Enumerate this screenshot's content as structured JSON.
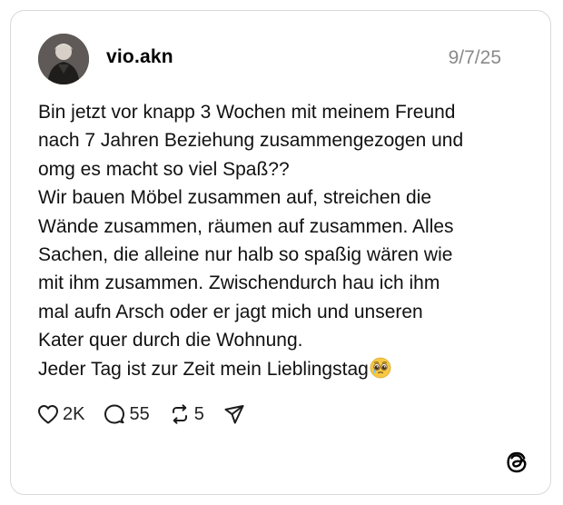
{
  "post": {
    "username": "vio.akn",
    "date": "9/7/25",
    "lines": [
      "Bin jetzt vor knapp 3 Wochen mit meinem Freund",
      "nach 7 Jahren Beziehung zusammengezogen und",
      "omg es macht so viel Spaß??",
      "Wir bauen Möbel zusammen auf, streichen die",
      "Wände zusammen, räumen auf zusammen. Alles",
      "Sachen, die alleine nur halb so spaßig wären wie",
      "mit ihm zusammen. Zwischendurch hau ich ihm",
      "mal aufn Arsch oder er jagt mich und unseren",
      "Kater quer durch die Wohnung.",
      "Jeder Tag ist zur Zeit mein Lieblingstag"
    ],
    "emoji": "pleading-face-emoji"
  },
  "actions": {
    "likes": "2K",
    "replies": "55",
    "reposts": "5",
    "icons": [
      "heart-icon",
      "comment-icon",
      "repost-icon",
      "share-icon"
    ]
  },
  "brand": {
    "logo": "threads-logo-icon"
  }
}
